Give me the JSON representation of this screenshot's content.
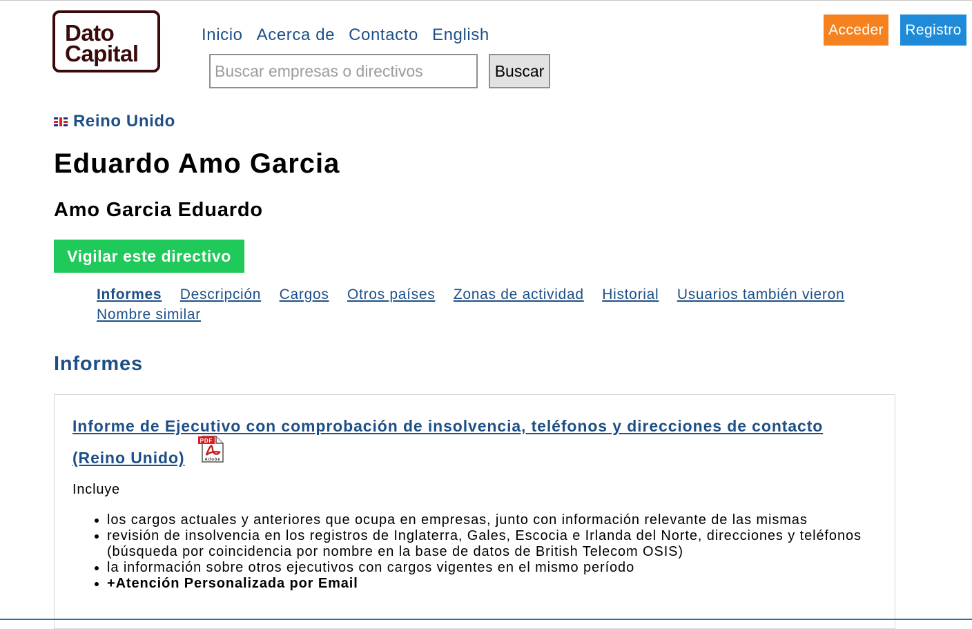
{
  "logo": {
    "line1": "Dato",
    "line2": "Capital"
  },
  "nav": [
    "Inicio",
    "Acerca de",
    "Contacto",
    "English"
  ],
  "search": {
    "placeholder": "Buscar empresas o directivos",
    "button": "Buscar"
  },
  "auth": {
    "login": "Acceder",
    "register": "Registro"
  },
  "country": "Reino Unido",
  "person": {
    "name": "Eduardo Amo Garcia",
    "alt_name": "Amo Garcia Eduardo"
  },
  "watch_button": "Vigilar este directivo",
  "sections": [
    {
      "label": "Informes",
      "active": true
    },
    {
      "label": "Descripción"
    },
    {
      "label": "Cargos"
    },
    {
      "label": "Otros países"
    },
    {
      "label": "Zonas de actividad"
    },
    {
      "label": "Historial"
    },
    {
      "label": "Usuarios también vieron"
    },
    {
      "label": "Nombre similar"
    }
  ],
  "reports": {
    "heading": "Informes",
    "title": "Informe de Ejecutivo con comprobación de insolvencia, teléfonos y direcciones de contacto (Reino Unido)",
    "pdf_label": "PDF",
    "pdf_brand": "Adobe",
    "includes_label": "Incluye",
    "items": [
      "los cargos actuales y anteriores que ocupa en empresas, junto con información relevante de las mismas",
      "revisión de insolvencia en los registros de Inglaterra, Gales, Escocia e Irlanda del Norte, direcciones y teléfonos (búsqueda por coincidencia por nombre en la base de datos de British Telecom OSIS)",
      "la información sobre otros ejecutivos con cargos vigentes en el mismo período",
      "+Atención Personalizada por Email"
    ]
  },
  "colors": {
    "link": "#1d4f86",
    "login": "#f5821f",
    "register": "#1f8ad8",
    "watch": "#1fc95a",
    "logo": "#3a0a0a"
  }
}
